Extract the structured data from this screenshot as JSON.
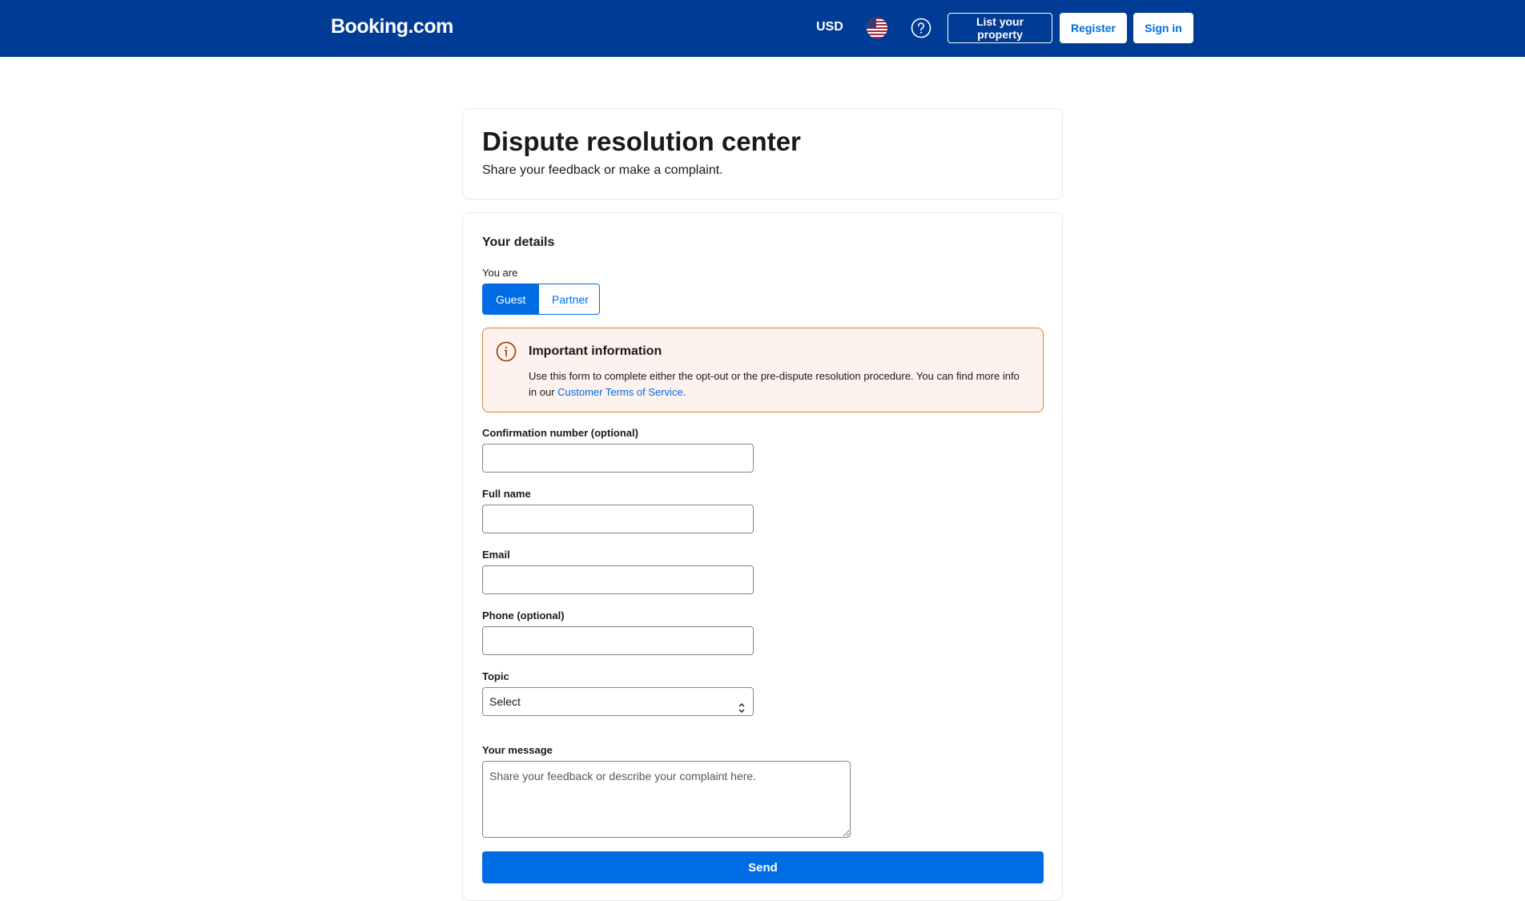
{
  "header": {
    "logo": "Booking.com",
    "currency": "USD",
    "list_property": "List your property",
    "register": "Register",
    "sign_in": "Sign in",
    "bg_color": "#003b95"
  },
  "intro": {
    "title": "Dispute resolution center",
    "subtitle": "Share your feedback or make a complaint."
  },
  "details": {
    "section_title": "Your details",
    "you_are_label": "You are",
    "toggle": {
      "guest": "Guest",
      "partner": "Partner",
      "selected": "Guest"
    }
  },
  "notice": {
    "title": "Important information",
    "body": "Use this form to complete either the opt-out or the pre-dispute resolution procedure. You can find more info in our ",
    "link": "Customer Terms of Service",
    "suffix": "."
  },
  "form": {
    "confirmation": {
      "label": "Confirmation number (optional)",
      "value": ""
    },
    "full_name": {
      "label": "Full name",
      "value": ""
    },
    "email": {
      "label": "Email",
      "value": ""
    },
    "phone": {
      "label": "Phone (optional)",
      "value": ""
    },
    "topic": {
      "label": "Topic",
      "value": "Select"
    },
    "message": {
      "label": "Your message",
      "placeholder": "Share your feedback or describe your complaint here."
    },
    "send": "Send"
  },
  "colors": {
    "accent": "#006ce4",
    "notice_bg": "#fdf2ed",
    "notice_border": "#e38235"
  }
}
